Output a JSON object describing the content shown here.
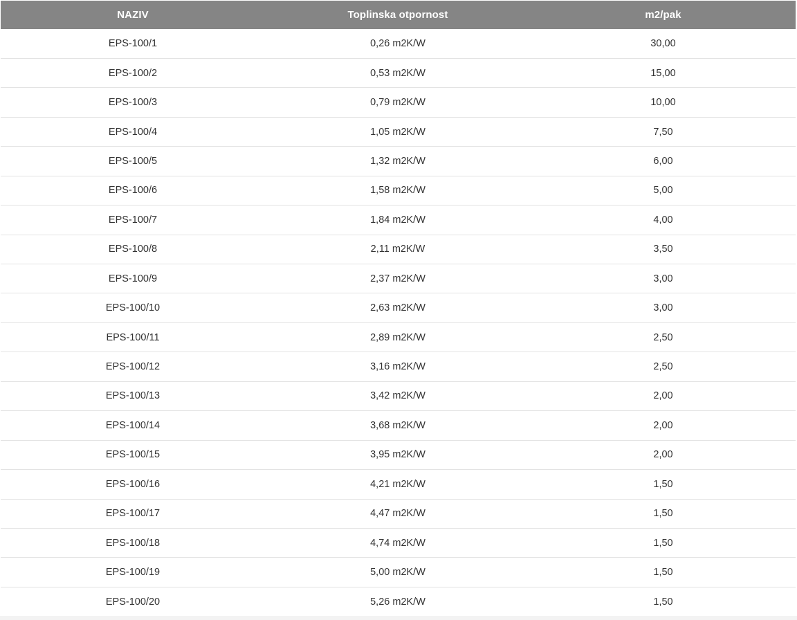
{
  "table": {
    "headers": [
      "NAZIV",
      "Toplinska otpornost",
      "m2/pak"
    ],
    "rows": [
      [
        "EPS-100/1",
        "0,26 m2K/W",
        "30,00"
      ],
      [
        "EPS-100/2",
        "0,53 m2K/W",
        "15,00"
      ],
      [
        "EPS-100/3",
        "0,79 m2K/W",
        "10,00"
      ],
      [
        "EPS-100/4",
        "1,05 m2K/W",
        "7,50"
      ],
      [
        "EPS-100/5",
        "1,32 m2K/W",
        "6,00"
      ],
      [
        "EPS-100/6",
        "1,58 m2K/W",
        "5,00"
      ],
      [
        "EPS-100/7",
        "1,84 m2K/W",
        "4,00"
      ],
      [
        "EPS-100/8",
        "2,11 m2K/W",
        "3,50"
      ],
      [
        "EPS-100/9",
        "2,37 m2K/W",
        "3,00"
      ],
      [
        "EPS-100/10",
        "2,63 m2K/W",
        "3,00"
      ],
      [
        "EPS-100/11",
        "2,89 m2K/W",
        "2,50"
      ],
      [
        "EPS-100/12",
        "3,16 m2K/W",
        "2,50"
      ],
      [
        "EPS-100/13",
        "3,42 m2K/W",
        "2,00"
      ],
      [
        "EPS-100/14",
        "3,68 m2K/W",
        "2,00"
      ],
      [
        "EPS-100/15",
        "3,95 m2K/W",
        "2,00"
      ],
      [
        "EPS-100/16",
        "4,21 m2K/W",
        "1,50"
      ],
      [
        "EPS-100/17",
        "4,47 m2K/W",
        "1,50"
      ],
      [
        "EPS-100/18",
        "4,74 m2K/W",
        "1,50"
      ],
      [
        "EPS-100/19",
        "5,00 m2K/W",
        "1,50"
      ],
      [
        "EPS-100/20",
        "5,26 m2K/W",
        "1,50"
      ]
    ]
  },
  "colors": {
    "header_bg": "#858585",
    "header_text": "#ffffff",
    "row_text": "#333333",
    "row_divider": "#e3e3e3"
  }
}
